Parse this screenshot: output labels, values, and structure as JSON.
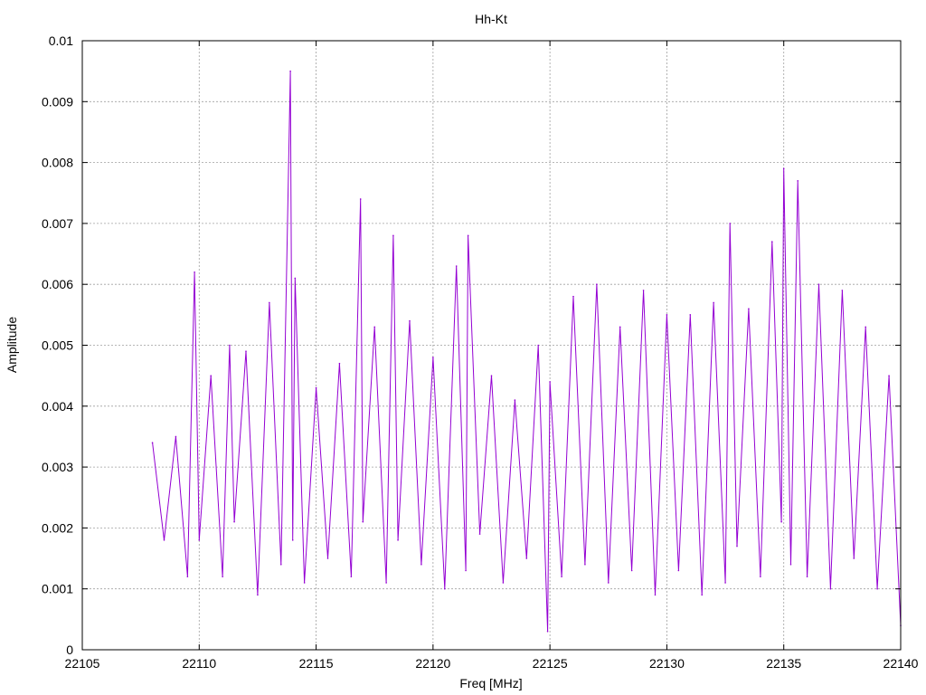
{
  "chart_data": {
    "type": "line",
    "title": "Hh-Kt",
    "xlabel": "Freq [MHz]",
    "ylabel": "Amplitude",
    "xlim": [
      22105,
      22140
    ],
    "ylim": [
      0,
      0.01
    ],
    "x_ticks": [
      22105,
      22110,
      22115,
      22120,
      22125,
      22130,
      22135,
      22140
    ],
    "x_tick_labels": [
      "22105",
      "22110",
      "22115",
      "22120",
      "22125",
      "22130",
      "22135",
      "22140"
    ],
    "y_ticks": [
      0,
      0.001,
      0.002,
      0.003,
      0.004,
      0.005,
      0.006,
      0.007,
      0.008,
      0.009,
      0.01
    ],
    "y_tick_labels": [
      "0",
      "0.001",
      "0.002",
      "0.003",
      "0.004",
      "0.005",
      "0.006",
      "0.007",
      "0.008",
      "0.009",
      "0.01"
    ],
    "grid": true,
    "line_color": "#9400d3",
    "series": [
      {
        "x": [
          22108.0,
          22108.5,
          22109.0,
          22109.5,
          22109.8,
          22110.0,
          22110.5,
          22111.0,
          22111.3,
          22111.5,
          22112.0,
          22112.5,
          22113.0,
          22113.5,
          22113.9,
          22114.0,
          22114.1,
          22114.5,
          22115.0,
          22115.5,
          22116.0,
          22116.5,
          22116.9,
          22117.0,
          22117.5,
          22118.0,
          22118.3,
          22118.5,
          22119.0,
          22119.5,
          22120.0,
          22120.5,
          22121.0,
          22121.4,
          22121.5,
          22122.0,
          22122.5,
          22123.0,
          22123.5,
          22124.0,
          22124.5,
          22124.9,
          22125.0,
          22125.5,
          22126.0,
          22126.5,
          22127.0,
          22127.5,
          22128.0,
          22128.5,
          22129.0,
          22129.5,
          22130.0,
          22130.5,
          22131.0,
          22131.5,
          22132.0,
          22132.5,
          22132.7,
          22133.0,
          22133.5,
          22134.0,
          22134.5,
          22134.9,
          22135.0,
          22135.3,
          22135.6,
          22136.0,
          22136.5,
          22137.0,
          22137.5,
          22138.0,
          22138.5,
          22139.0,
          22139.5,
          22140.0
        ],
        "y": [
          0.0034,
          0.0018,
          0.0035,
          0.0012,
          0.0062,
          0.0018,
          0.0045,
          0.0012,
          0.005,
          0.0021,
          0.0049,
          0.0009,
          0.0057,
          0.0014,
          0.0095,
          0.0018,
          0.0061,
          0.0011,
          0.0043,
          0.0015,
          0.0047,
          0.0012,
          0.0074,
          0.0021,
          0.0053,
          0.0011,
          0.0068,
          0.0018,
          0.0054,
          0.0014,
          0.0048,
          0.001,
          0.0063,
          0.0013,
          0.0068,
          0.0019,
          0.0045,
          0.0011,
          0.0041,
          0.0015,
          0.005,
          0.0003,
          0.0044,
          0.0012,
          0.0058,
          0.0014,
          0.006,
          0.0011,
          0.0053,
          0.0013,
          0.0059,
          0.0009,
          0.0055,
          0.0013,
          0.0055,
          0.0009,
          0.0057,
          0.0011,
          0.007,
          0.0017,
          0.0056,
          0.0012,
          0.0067,
          0.0021,
          0.0079,
          0.0014,
          0.0077,
          0.0012,
          0.006,
          0.001,
          0.0059,
          0.0015,
          0.0053,
          0.001,
          0.0045,
          0.0004
        ]
      }
    ]
  }
}
